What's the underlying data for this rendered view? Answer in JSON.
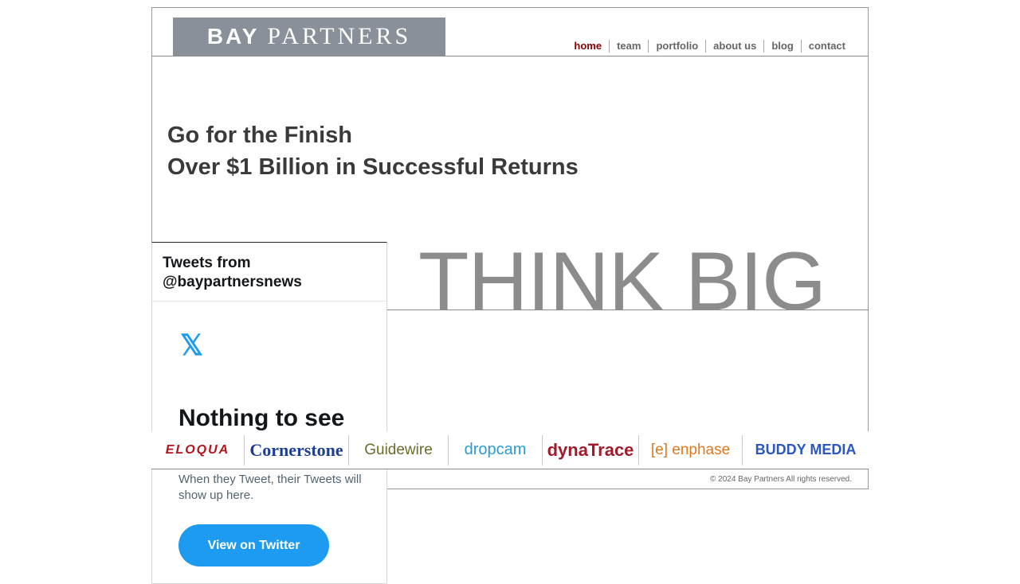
{
  "brand": {
    "logo_bold": "BAY",
    "logo_rest": "PARTNERS"
  },
  "nav": [
    {
      "label": "home",
      "active": true
    },
    {
      "label": "team"
    },
    {
      "label": "portfolio"
    },
    {
      "label": "about us"
    },
    {
      "label": "blog"
    },
    {
      "label": "contact"
    }
  ],
  "hero": {
    "line1": "Go for the Finish",
    "line2": "Over $1 Billion in Successful Returns",
    "tagline": "THINK BIG"
  },
  "twitter": {
    "header": "Tweets from @baypartnersnews",
    "icon": "x-logo-icon",
    "icon_glyph": "𝕏",
    "empty_title": "Nothing to see",
    "empty_body": "When they Tweet, their Tweets will show up here.",
    "button": "View on Twitter"
  },
  "portfolio_logos": [
    {
      "name": "ELOQUA",
      "color": "#b5121b"
    },
    {
      "name": "Cornerstone",
      "color": "#1c3f8f"
    },
    {
      "name": "Guidewire",
      "color": "#6b6b2a"
    },
    {
      "name": "dropcam",
      "color": "#2b9ad6"
    },
    {
      "name": "dynaTrace",
      "color": "#a01c2c"
    },
    {
      "name": "[e] enphase",
      "color": "#e0781e"
    },
    {
      "name": "BUDDY MEDIA",
      "color": "#2a57c4"
    }
  ],
  "footer": {
    "copyright": "© 2024 Bay Partners All rights reserved."
  }
}
